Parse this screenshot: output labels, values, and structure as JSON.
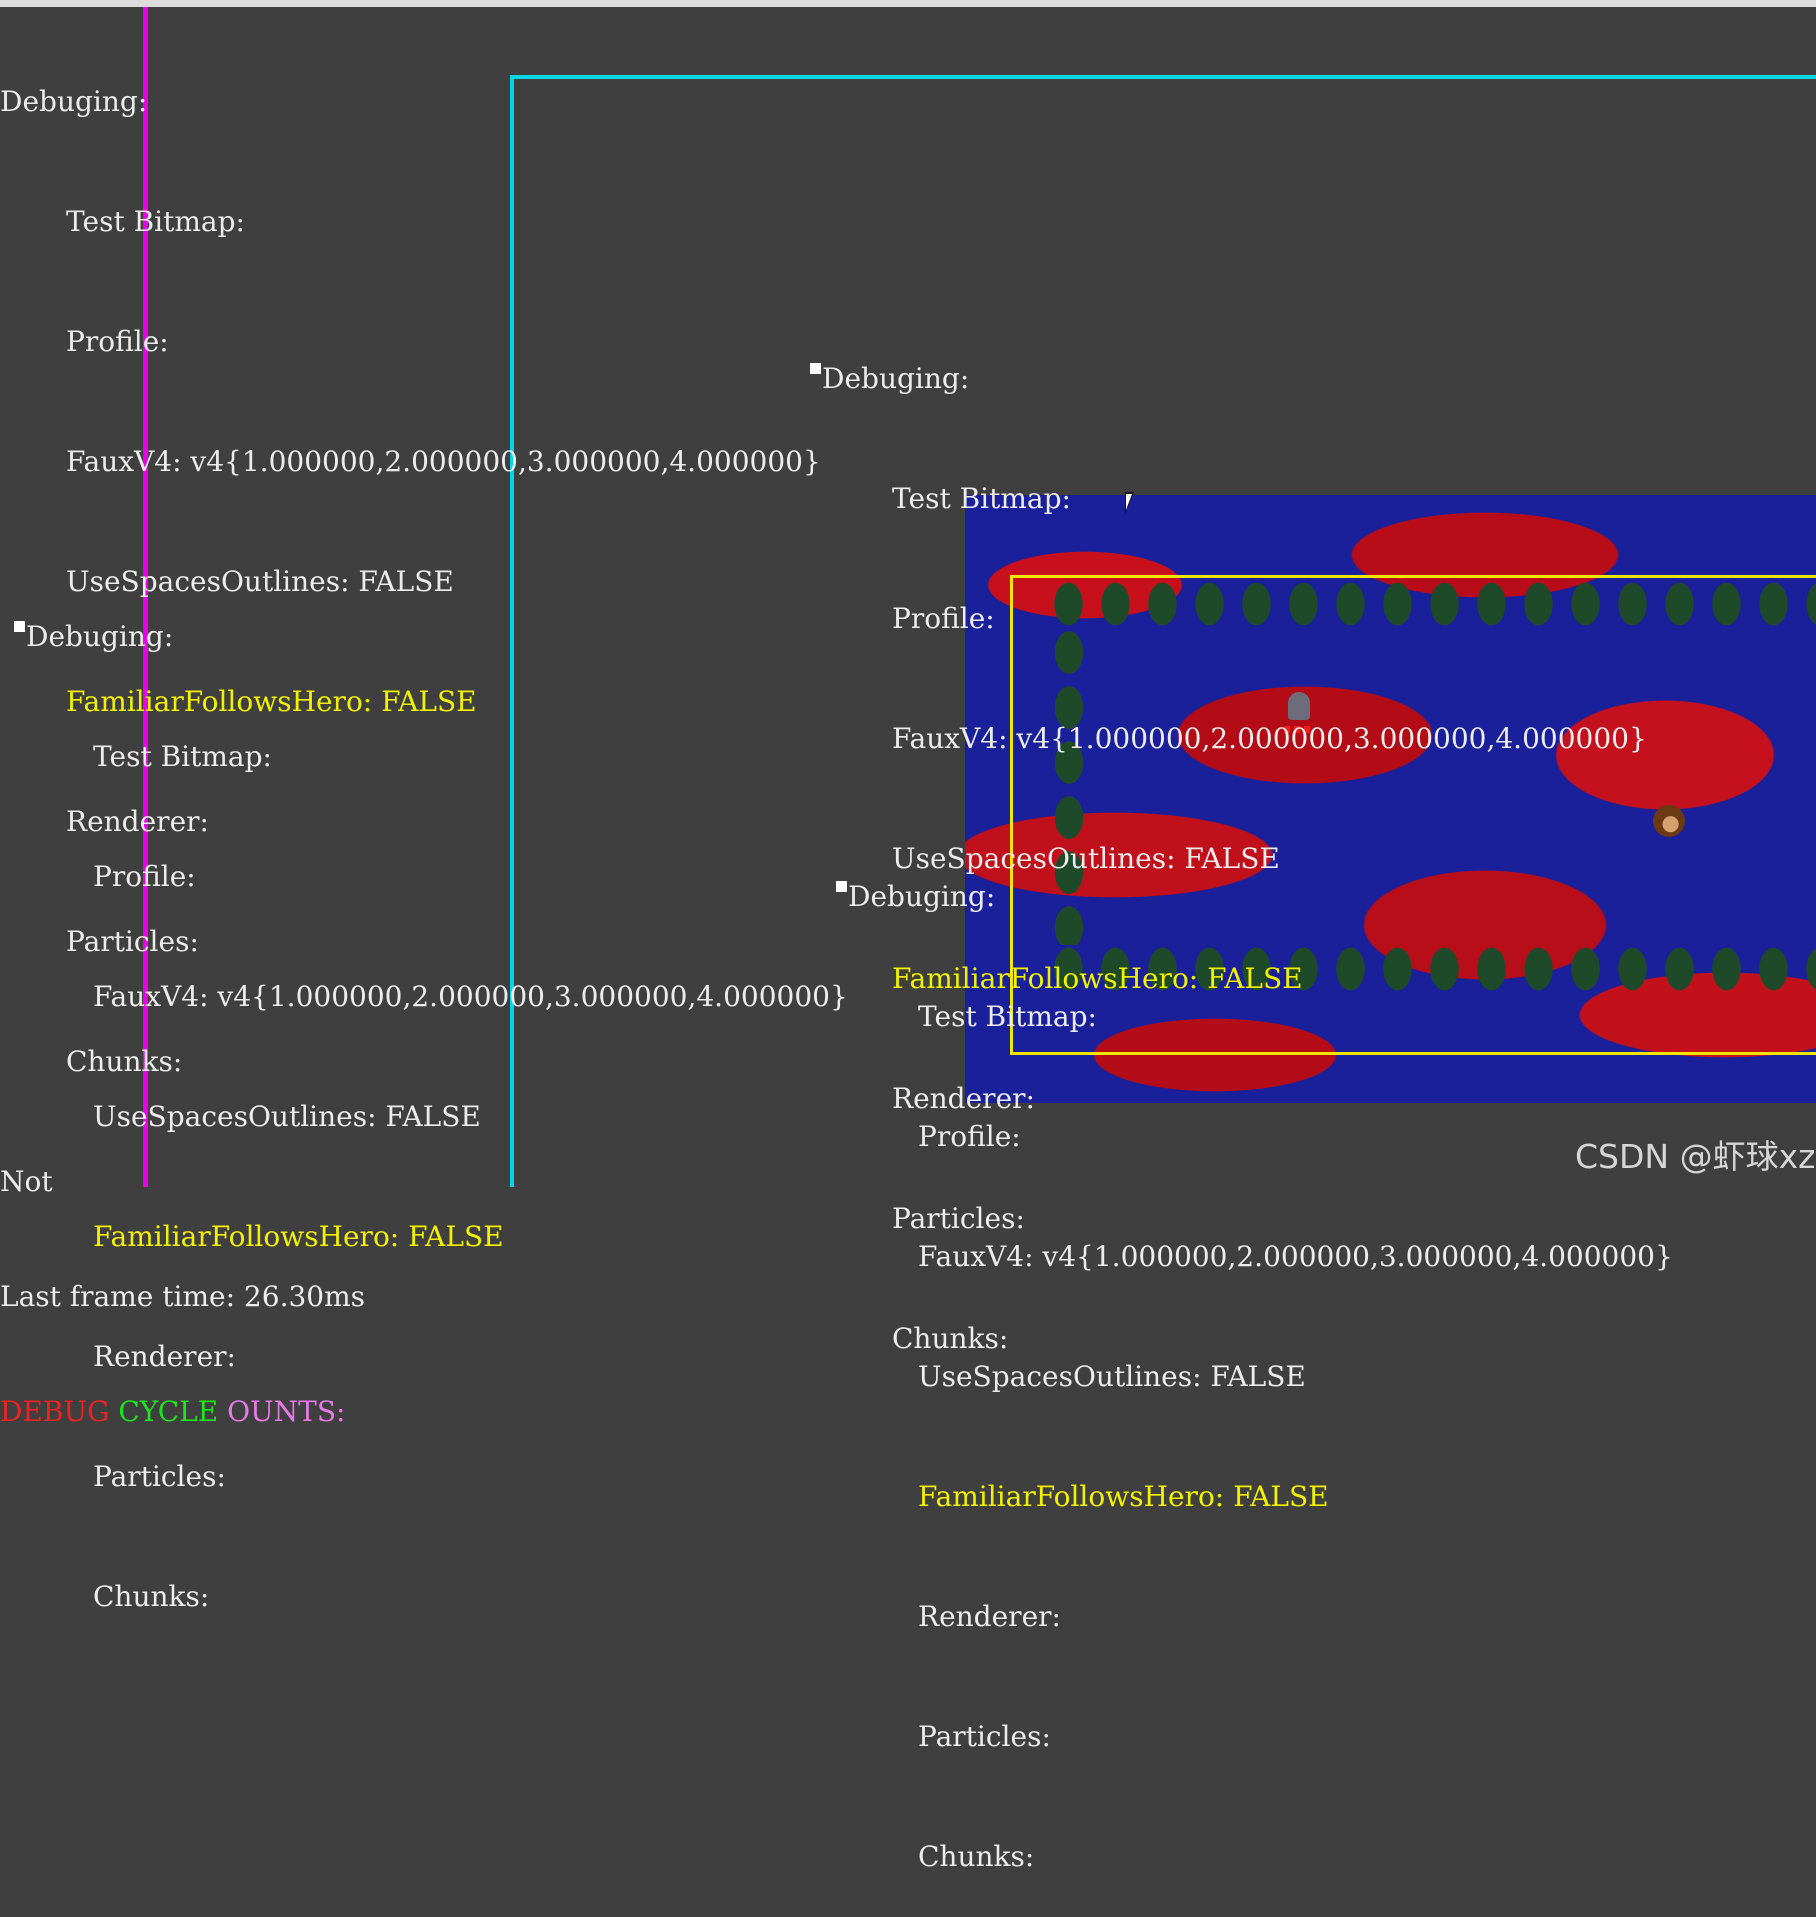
{
  "panel_top_left": {
    "title": "Debuging:",
    "items": [
      "Test Bitmap:",
      "Profile:",
      "FauxV4: v4{1.000000,2.000000,3.000000,4.000000}",
      "UseSpacesOutlines: FALSE"
    ],
    "highlight": "FamiliarFollowsHero: FALSE",
    "items2": [
      "Renderer:",
      "Particles:",
      "Chunks:"
    ],
    "not_label": "Not",
    "frame_time": "Last frame time: 26.30ms",
    "cycle_counts": {
      "part1": "DEBUG",
      "part2": "CYCLE",
      "part3": "OUNTS:"
    }
  },
  "panel_mid_left": {
    "title": "Debuging:",
    "items": [
      "Test Bitmap:",
      "Profile:",
      "FauxV4: v4{1.000000,2.000000,3.000000,4.000000}",
      "UseSpacesOutlines: FALSE"
    ],
    "highlight": "FamiliarFollowsHero: FALSE",
    "items2": [
      "Renderer:",
      "Particles:",
      "Chunks:"
    ]
  },
  "panel_top_right": {
    "title": "Debuging:",
    "items": [
      "Test Bitmap:",
      "Profile:",
      "FauxV4: v4{1.000000,2.000000,3.000000,4.000000}",
      "UseSpacesOutlines: FALSE"
    ],
    "highlight": "FamiliarFollowsHero: FALSE",
    "items2": [
      "Renderer:",
      "Particles:",
      "Chunks:"
    ]
  },
  "panel_bottom_right": {
    "title": "Debuging:",
    "items": [
      "Test Bitmap:",
      "Profile:",
      "FauxV4: v4{1.000000,2.000000,3.000000,4.000000}",
      "UseSpacesOutlines: FALSE"
    ],
    "highlight": "FamiliarFollowsHero: FALSE",
    "items2": [
      "Renderer:",
      "Particles:",
      "Chunks:"
    ]
  },
  "watermark": "CSDN @虾球xz",
  "colors": {
    "background": "#3f3f3f",
    "highlight_text": "#f2f200",
    "cyan_outline": "#00d8e8",
    "magenta_line": "#e800e8",
    "yellow_outline": "#f2e600"
  }
}
